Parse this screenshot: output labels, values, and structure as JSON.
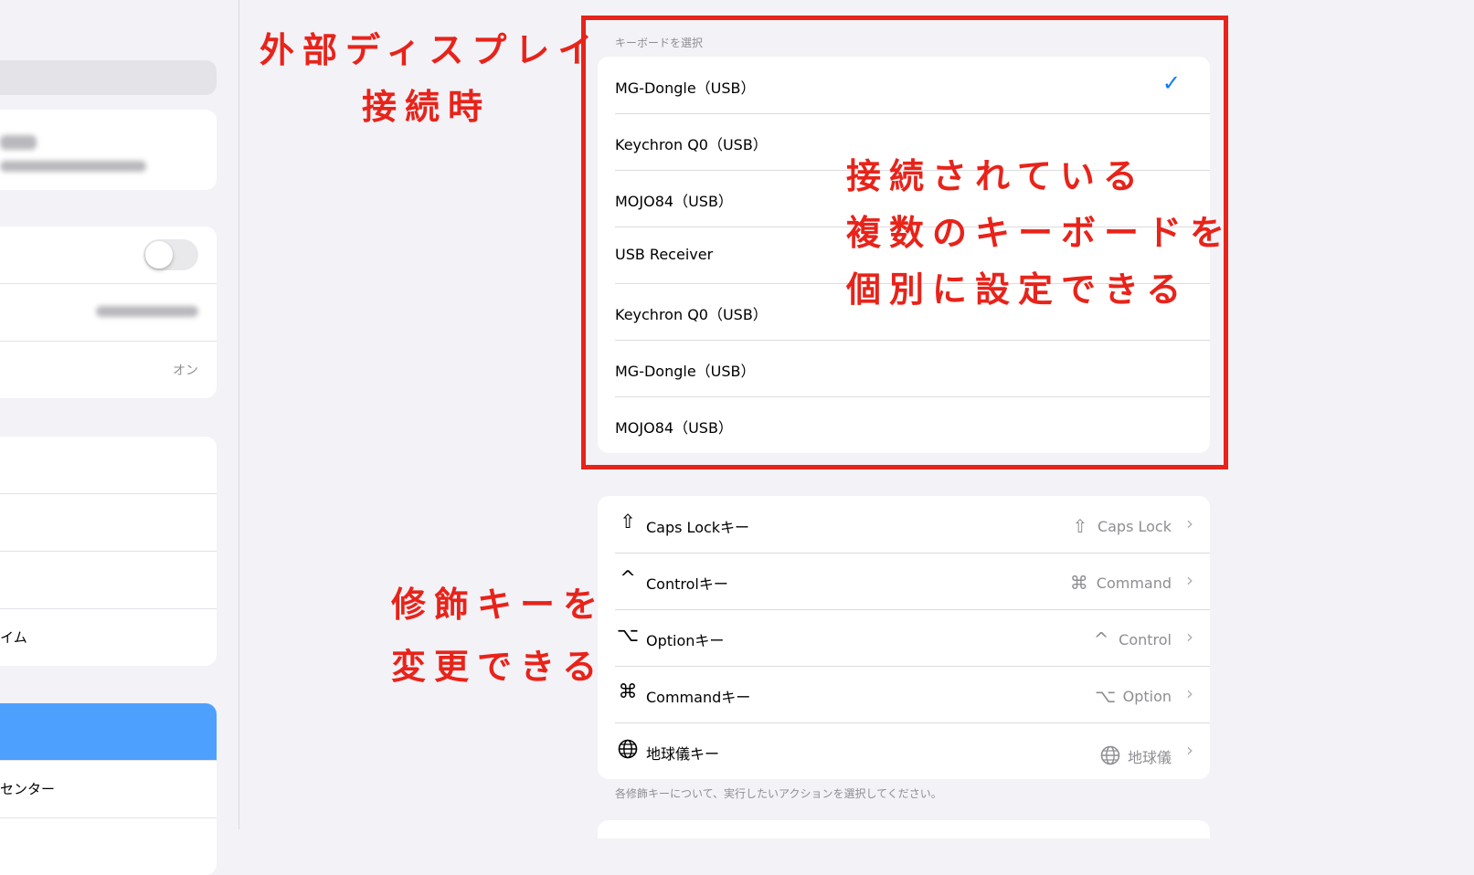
{
  "sidebar": {
    "row_value_on": "オン",
    "row_partial_1": "イム",
    "row_partial_2": "センター"
  },
  "keyboards": {
    "header": "キーボードを選択",
    "items": [
      {
        "label": "MG-Dongle（USB）",
        "selected": true
      },
      {
        "label": "Keychron Q0（USB）",
        "selected": false
      },
      {
        "label": "MOJO84（USB）",
        "selected": false
      },
      {
        "label": "USB Receiver",
        "selected": false
      },
      {
        "label": "Keychron Q0（USB）",
        "selected": false
      },
      {
        "label": "MG-Dongle（USB）",
        "selected": false
      },
      {
        "label": "MOJO84（USB）",
        "selected": false
      }
    ],
    "checkmark": "✓"
  },
  "modifiers": {
    "items": [
      {
        "icon": "shift-arrow-icon",
        "glyph": "⇧",
        "label": "Caps Lockキー",
        "value_icon": "shift-arrow-icon",
        "value_glyph": "⇧",
        "value": "Caps Lock"
      },
      {
        "icon": "control-caret-icon",
        "glyph": "^",
        "label": "Controlキー",
        "value_icon": "command-icon",
        "value_glyph": "⌘",
        "value": "Command"
      },
      {
        "icon": "option-icon",
        "glyph": "⌥",
        "label": "Optionキー",
        "value_icon": "control-caret-icon",
        "value_glyph": "^",
        "value": "Control"
      },
      {
        "icon": "command-icon",
        "glyph": "⌘",
        "label": "Commandキー",
        "value_icon": "option-icon",
        "value_glyph": "⌥",
        "value": "Option"
      },
      {
        "icon": "globe-icon",
        "glyph": "🌐",
        "label": "地球儀キー",
        "value_icon": "globe-icon",
        "value_glyph": "🌐",
        "value": "地球儀"
      }
    ],
    "chevron": "›",
    "footer": "各修飾キーについて、実行したいアクションを選択してください。"
  },
  "annotations": {
    "external_display_line1": "外部ディスプレイ",
    "external_display_line2": "接続時",
    "multi_keyboard_line1": "接続されている",
    "multi_keyboard_line2": "複数のキーボードを",
    "multi_keyboard_line3": "個別に設定できる",
    "modifier_line1": "修飾キーを",
    "modifier_line2": "変更できる"
  },
  "colors": {
    "annotation_red": "#e8231a",
    "accent_blue": "#0a7aff",
    "sidebar_selected": "#4ea0ff",
    "background": "#f2f2f7"
  }
}
